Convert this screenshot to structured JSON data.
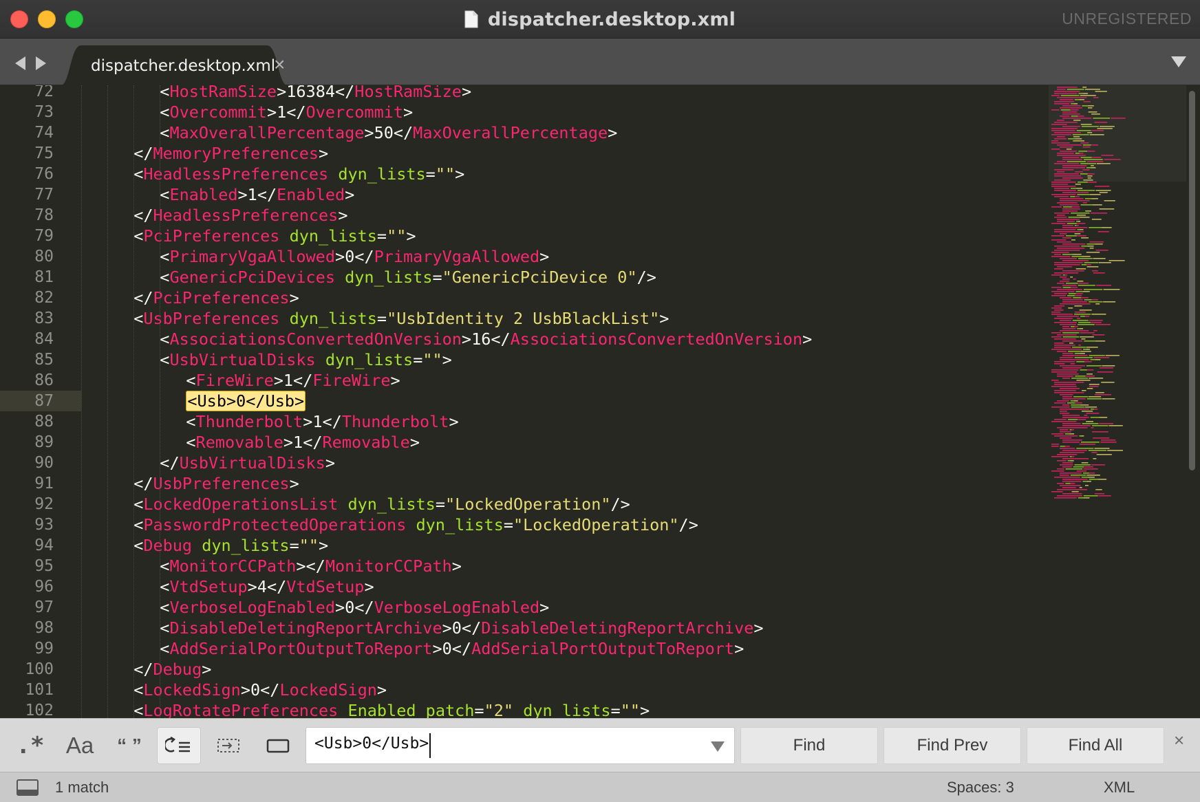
{
  "window": {
    "title": "dispatcher.desktop.xml",
    "license_notice": "UNREGISTERED"
  },
  "tabs": [
    {
      "label": "dispatcher.desktop.xml",
      "close_glyph": "×",
      "active": true
    }
  ],
  "icons": {
    "back": "chevron-left-icon",
    "forward": "chevron-right-icon",
    "tab_list": "triangle-down-icon",
    "document": "document-icon",
    "panel_toggle": "panel-icon"
  },
  "editor": {
    "current_line": 87,
    "lines": [
      {
        "n": 72,
        "indent": 3,
        "tokens": [
          [
            "p",
            "<"
          ],
          [
            "t",
            "HostRamSize"
          ],
          [
            "p",
            ">"
          ],
          [
            "v",
            "16384"
          ],
          [
            "p",
            "</"
          ],
          [
            "t",
            "HostRamSize"
          ],
          [
            "p",
            ">"
          ]
        ]
      },
      {
        "n": 73,
        "indent": 3,
        "tokens": [
          [
            "p",
            "<"
          ],
          [
            "t",
            "Overcommit"
          ],
          [
            "p",
            ">"
          ],
          [
            "v",
            "1"
          ],
          [
            "p",
            "</"
          ],
          [
            "t",
            "Overcommit"
          ],
          [
            "p",
            ">"
          ]
        ]
      },
      {
        "n": 74,
        "indent": 3,
        "tokens": [
          [
            "p",
            "<"
          ],
          [
            "t",
            "MaxOverallPercentage"
          ],
          [
            "p",
            ">"
          ],
          [
            "v",
            "50"
          ],
          [
            "p",
            "</"
          ],
          [
            "t",
            "MaxOverallPercentage"
          ],
          [
            "p",
            ">"
          ]
        ]
      },
      {
        "n": 75,
        "indent": 2,
        "tokens": [
          [
            "p",
            "</"
          ],
          [
            "t",
            "MemoryPreferences"
          ],
          [
            "p",
            ">"
          ]
        ]
      },
      {
        "n": 76,
        "indent": 2,
        "tokens": [
          [
            "p",
            "<"
          ],
          [
            "t",
            "HeadlessPreferences"
          ],
          [
            "p",
            " "
          ],
          [
            "a",
            "dyn_lists"
          ],
          [
            "p",
            "="
          ],
          [
            "s",
            "\"\""
          ],
          [
            "p",
            ">"
          ]
        ]
      },
      {
        "n": 77,
        "indent": 3,
        "tokens": [
          [
            "p",
            "<"
          ],
          [
            "t",
            "Enabled"
          ],
          [
            "p",
            ">"
          ],
          [
            "v",
            "1"
          ],
          [
            "p",
            "</"
          ],
          [
            "t",
            "Enabled"
          ],
          [
            "p",
            ">"
          ]
        ]
      },
      {
        "n": 78,
        "indent": 2,
        "tokens": [
          [
            "p",
            "</"
          ],
          [
            "t",
            "HeadlessPreferences"
          ],
          [
            "p",
            ">"
          ]
        ]
      },
      {
        "n": 79,
        "indent": 2,
        "tokens": [
          [
            "p",
            "<"
          ],
          [
            "t",
            "PciPreferences"
          ],
          [
            "p",
            " "
          ],
          [
            "a",
            "dyn_lists"
          ],
          [
            "p",
            "="
          ],
          [
            "s",
            "\"\""
          ],
          [
            "p",
            ">"
          ]
        ]
      },
      {
        "n": 80,
        "indent": 3,
        "tokens": [
          [
            "p",
            "<"
          ],
          [
            "t",
            "PrimaryVgaAllowed"
          ],
          [
            "p",
            ">"
          ],
          [
            "v",
            "0"
          ],
          [
            "p",
            "</"
          ],
          [
            "t",
            "PrimaryVgaAllowed"
          ],
          [
            "p",
            ">"
          ]
        ]
      },
      {
        "n": 81,
        "indent": 3,
        "tokens": [
          [
            "p",
            "<"
          ],
          [
            "t",
            "GenericPciDevices"
          ],
          [
            "p",
            " "
          ],
          [
            "a",
            "dyn_lists"
          ],
          [
            "p",
            "="
          ],
          [
            "s",
            "\"GenericPciDevice 0\""
          ],
          [
            "p",
            "/>"
          ]
        ]
      },
      {
        "n": 82,
        "indent": 2,
        "tokens": [
          [
            "p",
            "</"
          ],
          [
            "t",
            "PciPreferences"
          ],
          [
            "p",
            ">"
          ]
        ]
      },
      {
        "n": 83,
        "indent": 2,
        "tokens": [
          [
            "p",
            "<"
          ],
          [
            "t",
            "UsbPreferences"
          ],
          [
            "p",
            " "
          ],
          [
            "a",
            "dyn_lists"
          ],
          [
            "p",
            "="
          ],
          [
            "s",
            "\"UsbIdentity 2 UsbBlackList\""
          ],
          [
            "p",
            ">"
          ]
        ]
      },
      {
        "n": 84,
        "indent": 3,
        "tokens": [
          [
            "p",
            "<"
          ],
          [
            "t",
            "AssociationsConvertedOnVersion"
          ],
          [
            "p",
            ">"
          ],
          [
            "v",
            "16"
          ],
          [
            "p",
            "</"
          ],
          [
            "t",
            "AssociationsConvertedOnVersion"
          ],
          [
            "p",
            ">"
          ]
        ]
      },
      {
        "n": 85,
        "indent": 3,
        "tokens": [
          [
            "p",
            "<"
          ],
          [
            "t",
            "UsbVirtualDisks"
          ],
          [
            "p",
            " "
          ],
          [
            "a",
            "dyn_lists"
          ],
          [
            "p",
            "="
          ],
          [
            "s",
            "\"\""
          ],
          [
            "p",
            ">"
          ]
        ]
      },
      {
        "n": 86,
        "indent": 4,
        "tokens": [
          [
            "p",
            "<"
          ],
          [
            "t",
            "FireWire"
          ],
          [
            "p",
            ">"
          ],
          [
            "v",
            "1"
          ],
          [
            "p",
            "</"
          ],
          [
            "t",
            "FireWire"
          ],
          [
            "p",
            ">"
          ]
        ]
      },
      {
        "n": 87,
        "indent": 4,
        "tokens": [
          [
            "match",
            "<Usb>0</Usb>"
          ]
        ]
      },
      {
        "n": 88,
        "indent": 4,
        "tokens": [
          [
            "p",
            "<"
          ],
          [
            "t",
            "Thunderbolt"
          ],
          [
            "p",
            ">"
          ],
          [
            "v",
            "1"
          ],
          [
            "p",
            "</"
          ],
          [
            "t",
            "Thunderbolt"
          ],
          [
            "p",
            ">"
          ]
        ]
      },
      {
        "n": 89,
        "indent": 4,
        "tokens": [
          [
            "p",
            "<"
          ],
          [
            "t",
            "Removable"
          ],
          [
            "p",
            ">"
          ],
          [
            "v",
            "1"
          ],
          [
            "p",
            "</"
          ],
          [
            "t",
            "Removable"
          ],
          [
            "p",
            ">"
          ]
        ]
      },
      {
        "n": 90,
        "indent": 3,
        "tokens": [
          [
            "p",
            "</"
          ],
          [
            "t",
            "UsbVirtualDisks"
          ],
          [
            "p",
            ">"
          ]
        ]
      },
      {
        "n": 91,
        "indent": 2,
        "tokens": [
          [
            "p",
            "</"
          ],
          [
            "t",
            "UsbPreferences"
          ],
          [
            "p",
            ">"
          ]
        ]
      },
      {
        "n": 92,
        "indent": 2,
        "tokens": [
          [
            "p",
            "<"
          ],
          [
            "t",
            "LockedOperationsList"
          ],
          [
            "p",
            " "
          ],
          [
            "a",
            "dyn_lists"
          ],
          [
            "p",
            "="
          ],
          [
            "s",
            "\"LockedOperation\""
          ],
          [
            "p",
            "/>"
          ]
        ]
      },
      {
        "n": 93,
        "indent": 2,
        "tokens": [
          [
            "p",
            "<"
          ],
          [
            "t",
            "PasswordProtectedOperations"
          ],
          [
            "p",
            " "
          ],
          [
            "a",
            "dyn_lists"
          ],
          [
            "p",
            "="
          ],
          [
            "s",
            "\"LockedOperation\""
          ],
          [
            "p",
            "/>"
          ]
        ]
      },
      {
        "n": 94,
        "indent": 2,
        "tokens": [
          [
            "p",
            "<"
          ],
          [
            "t",
            "Debug"
          ],
          [
            "p",
            " "
          ],
          [
            "a",
            "dyn_lists"
          ],
          [
            "p",
            "="
          ],
          [
            "s",
            "\"\""
          ],
          [
            "p",
            ">"
          ]
        ]
      },
      {
        "n": 95,
        "indent": 3,
        "tokens": [
          [
            "p",
            "<"
          ],
          [
            "t",
            "MonitorCCPath"
          ],
          [
            "p",
            "></"
          ],
          [
            "t",
            "MonitorCCPath"
          ],
          [
            "p",
            ">"
          ]
        ]
      },
      {
        "n": 96,
        "indent": 3,
        "tokens": [
          [
            "p",
            "<"
          ],
          [
            "t",
            "VtdSetup"
          ],
          [
            "p",
            ">"
          ],
          [
            "v",
            "4"
          ],
          [
            "p",
            "</"
          ],
          [
            "t",
            "VtdSetup"
          ],
          [
            "p",
            ">"
          ]
        ]
      },
      {
        "n": 97,
        "indent": 3,
        "tokens": [
          [
            "p",
            "<"
          ],
          [
            "t",
            "VerboseLogEnabled"
          ],
          [
            "p",
            ">"
          ],
          [
            "v",
            "0"
          ],
          [
            "p",
            "</"
          ],
          [
            "t",
            "VerboseLogEnabled"
          ],
          [
            "p",
            ">"
          ]
        ]
      },
      {
        "n": 98,
        "indent": 3,
        "tokens": [
          [
            "p",
            "<"
          ],
          [
            "t",
            "DisableDeletingReportArchive"
          ],
          [
            "p",
            ">"
          ],
          [
            "v",
            "0"
          ],
          [
            "p",
            "</"
          ],
          [
            "t",
            "DisableDeletingReportArchive"
          ],
          [
            "p",
            ">"
          ]
        ]
      },
      {
        "n": 99,
        "indent": 3,
        "tokens": [
          [
            "p",
            "<"
          ],
          [
            "t",
            "AddSerialPortOutputToReport"
          ],
          [
            "p",
            ">"
          ],
          [
            "v",
            "0"
          ],
          [
            "p",
            "</"
          ],
          [
            "t",
            "AddSerialPortOutputToReport"
          ],
          [
            "p",
            ">"
          ]
        ]
      },
      {
        "n": 100,
        "indent": 2,
        "tokens": [
          [
            "p",
            "</"
          ],
          [
            "t",
            "Debug"
          ],
          [
            "p",
            ">"
          ]
        ]
      },
      {
        "n": 101,
        "indent": 2,
        "tokens": [
          [
            "p",
            "<"
          ],
          [
            "t",
            "LockedSign"
          ],
          [
            "p",
            ">"
          ],
          [
            "v",
            "0"
          ],
          [
            "p",
            "</"
          ],
          [
            "t",
            "LockedSign"
          ],
          [
            "p",
            ">"
          ]
        ]
      },
      {
        "n": 102,
        "indent": 2,
        "tokens": [
          [
            "p",
            "<"
          ],
          [
            "t",
            "LogRotatePreferences"
          ],
          [
            "p",
            " "
          ],
          [
            "a",
            "Enabled"
          ],
          [
            "p",
            " "
          ],
          [
            "a",
            "patch"
          ],
          [
            "p",
            "="
          ],
          [
            "s",
            "\"2\""
          ],
          [
            "p",
            " "
          ],
          [
            "a",
            "dyn_lists"
          ],
          [
            "p",
            "="
          ],
          [
            "s",
            "\"\""
          ],
          [
            "p",
            ">"
          ]
        ]
      }
    ]
  },
  "find_panel": {
    "options": [
      {
        "id": "regex",
        "glyph": ".*",
        "icon": "regex-icon",
        "active": false
      },
      {
        "id": "case",
        "glyph": "Aa",
        "icon": "case-sensitive-icon",
        "active": false
      },
      {
        "id": "word",
        "glyph": "“ ”",
        "icon": "whole-word-icon",
        "active": false
      },
      {
        "id": "wrap",
        "glyph": "",
        "icon": "wrap-icon",
        "active": true
      },
      {
        "id": "insel",
        "glyph": "",
        "icon": "in-selection-icon",
        "active": false
      },
      {
        "id": "highlight",
        "glyph": "",
        "icon": "highlight-matches-icon",
        "active": false
      }
    ],
    "query": "<Usb>0</Usb>",
    "buttons": {
      "find": "Find",
      "find_prev": "Find Prev",
      "find_all": "Find All"
    },
    "close_glyph": "×"
  },
  "status_bar": {
    "message": "1 match",
    "indentation": "Spaces: 3",
    "syntax": "XML"
  },
  "colors": {
    "background": "#272822",
    "tag": "#f92672",
    "attribute": "#a6e22e",
    "string": "#e6db74",
    "text": "#f8f8f2",
    "line_number": "#8f908a",
    "match_bg": "#ffe792"
  }
}
